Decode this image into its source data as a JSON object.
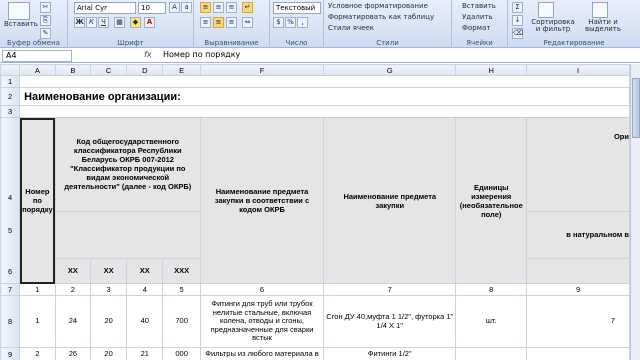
{
  "ribbon": {
    "paste_label": "Вставить",
    "clipboard_group": "Буфер обмена",
    "font_name": "Arial Cyr",
    "font_size": "10",
    "font_group": "Шрифт",
    "align_group": "Выравнивание",
    "number_format": "Текстовый",
    "number_group": "Число",
    "cond_format": "Условное форматирование",
    "format_table": "Форматировать как таблицу",
    "cell_styles": "Стили ячеек",
    "styles_group": "Стили",
    "insert_label": "Вставить",
    "delete_label": "Удалить",
    "format_label": "Формат",
    "cells_group": "Ячейки",
    "sort_label": "Сортировка и фильтр",
    "find_label": "Найти и выделить",
    "editing_group": "Редактирование",
    "bold": "Ж",
    "italic": "К",
    "underline": "Ч",
    "sum_icon": "Σ"
  },
  "formula_bar": {
    "cell_ref": "A4",
    "fx": "fx",
    "content": "Номер по порядку"
  },
  "columns": [
    "A",
    "B",
    "C",
    "D",
    "E",
    "F",
    "G",
    "H",
    "I"
  ],
  "rows": {
    "r2_title": "Наименование организации:",
    "hdr_num": "Номер по порядку",
    "hdr_okrb": "Код общегосударственного классификатора Республики Беларусь ОКРБ 007-2012 \"Классификатор продукции по видам экономической деятельности\" (далее - код ОКРБ)",
    "hdr_name_okrb": "Наименование предмета закупки в соответствии с кодом ОКРБ",
    "hdr_name": "Наименование предмета закупки",
    "hdr_unit": "Единицы измерения (необязательное поле)",
    "hdr_i_top": "Ори",
    "hdr_i_sub": "в натуральном в",
    "sub_codes": [
      "ХХ",
      "ХХ",
      "ХХ",
      "ХХХ"
    ],
    "col_nums": [
      "1",
      "2",
      "3",
      "4",
      "5",
      "6",
      "7",
      "8",
      "9"
    ],
    "data1": {
      "a": "1",
      "b": "24",
      "c": "20",
      "d": "40",
      "e": "700",
      "f": "Фитинги для труб или трубок нелитые стальные, включая колена, отводы и сгоны, предназначенные для сварки встык",
      "g": "Сгон ДУ 40,муфта 1 1/2\", футорка 1\" 1/4 Х 1\"",
      "h": "шт.",
      "i": "7"
    },
    "data2": {
      "a": "2",
      "b": "26",
      "c": "20",
      "d": "21",
      "e": "000",
      "f": "Фильтры из любого материала в",
      "g": "Фитинги 1/2\"",
      "h": "",
      "i": ""
    }
  },
  "row_numbers": [
    "1",
    "2",
    "3",
    "4",
    "5",
    "6",
    "7",
    "8",
    "9"
  ]
}
